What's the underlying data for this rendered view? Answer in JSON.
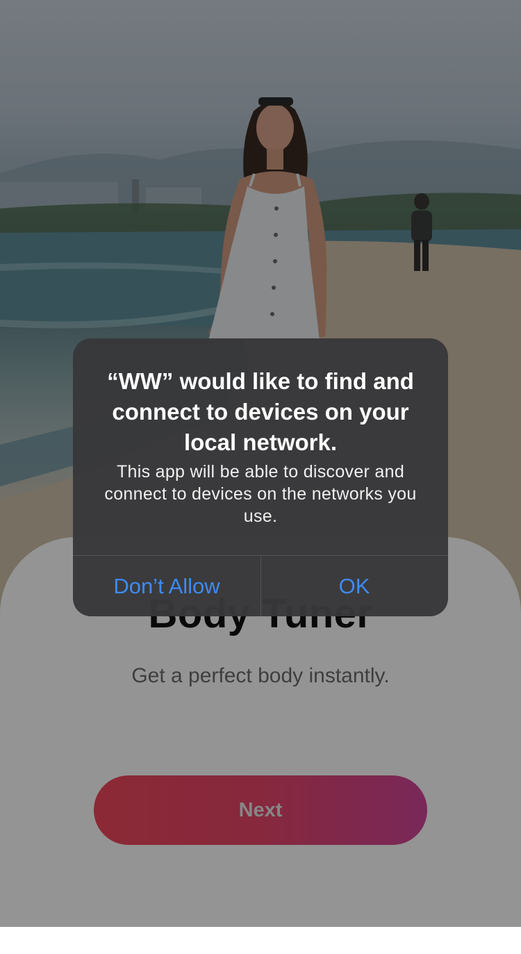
{
  "app": {
    "title": "Body Tuner",
    "subtitle": "Get a perfect body instantly.",
    "next_label": "Next"
  },
  "alert": {
    "title": "“WW” would like to find and connect to devices on your local network.",
    "message": "This app will be able to discover and connect to devices on the networks you use.",
    "deny_label": "Don’t Allow",
    "ok_label": "OK"
  },
  "colors": {
    "accent_blue": "#3d8bf2",
    "button_gradient_start": "#f0485c",
    "button_gradient_end": "#d1459a",
    "alert_bg": "#38383a"
  }
}
